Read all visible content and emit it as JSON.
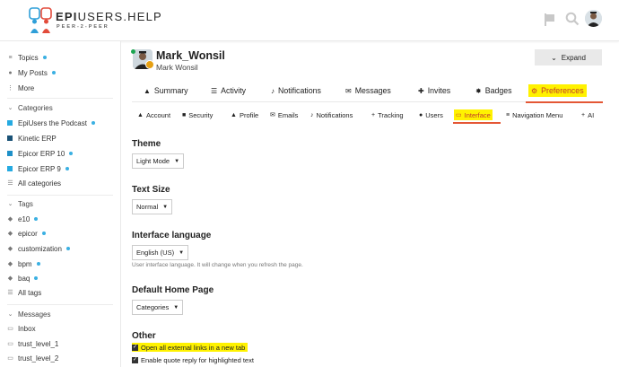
{
  "header": {
    "logo_prefix": "EPI",
    "logo_main": "USERS.HELP",
    "logo_sub": "PEER-2-PEER"
  },
  "sidebar": {
    "top_items": [
      {
        "label": "Topics",
        "icon": "stack-icon",
        "dot": true
      },
      {
        "label": "My Posts",
        "icon": "user-icon",
        "dot": true
      },
      {
        "label": "More",
        "icon": "vertical-dots-icon",
        "dot": false
      }
    ],
    "categories_heading": "Categories",
    "categories": [
      {
        "label": "EpiUsers the Podcast",
        "color": "#25aae1",
        "dot": true
      },
      {
        "label": "Kinetic ERP",
        "color": "#1a5276",
        "dot": false
      },
      {
        "label": "Epicor ERP 10",
        "color": "#1e90c8",
        "dot": true
      },
      {
        "label": "Epicor ERP 9",
        "color": "#25aae1",
        "dot": true
      },
      {
        "label": "All categories",
        "icon": "list-icon",
        "dot": false
      }
    ],
    "tags_heading": "Tags",
    "tags": [
      {
        "label": "e10",
        "dot": true
      },
      {
        "label": "epicor",
        "dot": true
      },
      {
        "label": "customization",
        "dot": true
      },
      {
        "label": "bpm",
        "dot": true
      },
      {
        "label": "baq",
        "dot": true
      },
      {
        "label": "All tags",
        "icon": "list-icon",
        "dot": false
      }
    ],
    "messages_heading": "Messages",
    "messages": [
      {
        "label": "Inbox"
      },
      {
        "label": "trust_level_1"
      },
      {
        "label": "trust_level_2"
      }
    ]
  },
  "profile": {
    "username": "Mark_Wonsil",
    "full_name": "Mark Wonsil",
    "expand_label": "Expand"
  },
  "main_tabs": [
    {
      "label": "Summary",
      "icon": "person-icon"
    },
    {
      "label": "Activity",
      "icon": "stream-icon"
    },
    {
      "label": "Notifications",
      "icon": "bell-icon"
    },
    {
      "label": "Messages",
      "icon": "envelope-icon"
    },
    {
      "label": "Invites",
      "icon": "user-plus-icon"
    },
    {
      "label": "Badges",
      "icon": "certificate-icon"
    },
    {
      "label": "Preferences",
      "icon": "gear-icon",
      "active": true
    }
  ],
  "pref_tabs": [
    {
      "label": "Account",
      "icon": "user-icon"
    },
    {
      "label": "Security",
      "icon": "lock-icon"
    },
    {
      "label": "Profile",
      "icon": "user-icon"
    },
    {
      "label": "Emails",
      "icon": "envelope-icon"
    },
    {
      "label": "Notifications",
      "icon": "bell-icon"
    },
    {
      "label": "Tracking",
      "icon": "plus-icon"
    },
    {
      "label": "Users",
      "icon": "users-icon"
    },
    {
      "label": "Interface",
      "icon": "desktop-icon",
      "active": true
    },
    {
      "label": "Navigation Menu",
      "icon": "bars-icon"
    },
    {
      "label": "AI",
      "icon": "plus-icon"
    }
  ],
  "settings": {
    "theme": {
      "title": "Theme",
      "value": "Light Mode"
    },
    "text_size": {
      "title": "Text Size",
      "value": "Normal"
    },
    "language": {
      "title": "Interface language",
      "value": "English (US)",
      "help": "User interface language. It will change when you refresh the page."
    },
    "home_page": {
      "title": "Default Home Page",
      "value": "Categories"
    },
    "other": {
      "title": "Other",
      "options": [
        {
          "label": "Open all external links in a new tab",
          "checked": true
        },
        {
          "label": "Enable quote reply for highlighted text",
          "checked": true
        }
      ]
    }
  },
  "colors": {
    "accent": "#e45735",
    "highlight": "#fff200",
    "dot": "#3ab0e2"
  }
}
